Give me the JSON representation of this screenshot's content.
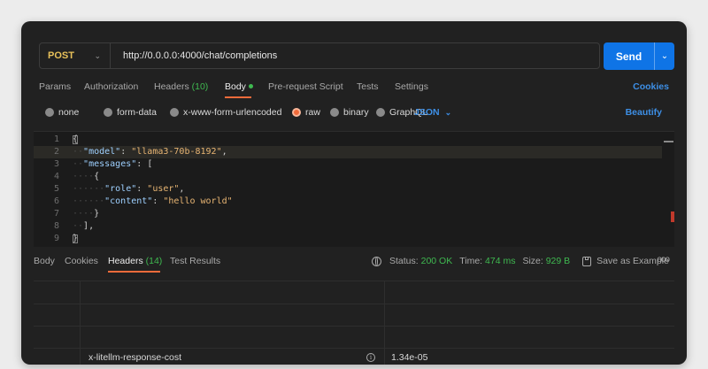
{
  "request": {
    "method": "POST",
    "url": "http://0.0.0.0:4000/chat/completions",
    "send_label": "Send"
  },
  "tabs": [
    {
      "label": "Params"
    },
    {
      "label": "Authorization"
    },
    {
      "label": "Headers",
      "count": "(10)"
    },
    {
      "label": "Body",
      "active": true
    },
    {
      "label": "Pre-request Script"
    },
    {
      "label": "Tests"
    },
    {
      "label": "Settings"
    }
  ],
  "cookies_label": "Cookies",
  "body_types": [
    {
      "label": "none"
    },
    {
      "label": "form-data"
    },
    {
      "label": "x-www-form-urlencoded"
    },
    {
      "label": "raw",
      "checked": true
    },
    {
      "label": "binary"
    },
    {
      "label": "GraphQL"
    }
  ],
  "format": "JSON",
  "beautify_label": "Beautify",
  "editor": {
    "line_numbers": [
      "1",
      "2",
      "3",
      "4",
      "5",
      "6",
      "7",
      "8",
      "9"
    ],
    "t": {
      "open_brace": "{",
      "close_brace": "}",
      "model_key": "\"model\"",
      "model_val": "\"llama3-70b-8192\"",
      "messages_key": "\"messages\"",
      "open_bracket": "[",
      "close_bracket": "],",
      "role_key": "\"role\"",
      "role_val": "\"user\"",
      "content_key": "\"content\"",
      "content_val": "\"hello world\"",
      "colon": ": ",
      "comma": ","
    }
  },
  "response": {
    "tabs": [
      {
        "label": "Body"
      },
      {
        "label": "Cookies"
      },
      {
        "label": "Headers",
        "count": "(14)",
        "active": true
      },
      {
        "label": "Test Results"
      }
    ],
    "status_label": "Status:",
    "status_value": "200 OK",
    "time_label": "Time:",
    "time_value": "474 ms",
    "size_label": "Size:",
    "size_value": "929 B",
    "save_label": "Save as Example",
    "more_label": "ooo",
    "header_row": {
      "key": "x-litellm-response-cost",
      "value": "1.34e-05"
    }
  },
  "colors": {
    "accent_orange": "#f26b3a",
    "send_blue": "#0f74e6",
    "method_yellow": "#e8c15a",
    "status_green": "#3fb950",
    "link_blue": "#3d8fe6"
  }
}
